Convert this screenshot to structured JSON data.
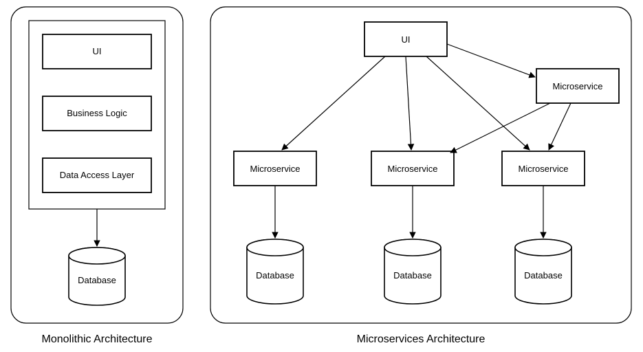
{
  "monolithic": {
    "caption": "Monolithic Architecture",
    "ui": "UI",
    "logic": "Business Logic",
    "data": "Data Access Layer",
    "db": "Database"
  },
  "microservices": {
    "caption": "Microservices Architecture",
    "ui": "UI",
    "ms1": "Microservice",
    "ms2": "Microservice",
    "ms3": "Microservice",
    "ms4": "Microservice",
    "db1": "Database",
    "db2": "Database",
    "db3": "Database"
  }
}
